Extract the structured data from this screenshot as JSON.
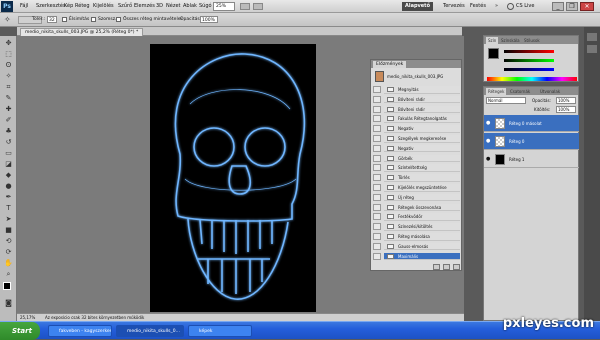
{
  "menu": {
    "logo": "Ps",
    "items": [
      "Fájl",
      "Szerkesztés",
      "Kép",
      "Réteg",
      "Kijelölés",
      "Szűrő",
      "Elemzés",
      "3D",
      "Nézet",
      "Ablak",
      "Súgó"
    ],
    "zoom": "25%",
    "workspaces": [
      "Alapvető",
      "Tervezés",
      "Festés"
    ],
    "ws_active": "Alapvető",
    "cslive": "CS Live"
  },
  "options": {
    "tolerance_label": "Toler.:",
    "tolerance_value": "32",
    "antialias": "Élsimítás",
    "contiguous": "Szomsz.",
    "all_layers": "Összes réteg mintavételei",
    "opacity_label": "Opacitás:",
    "opacity_value": "100%"
  },
  "document": {
    "tab": "medio_nikita_skulls_003.JPG @ 25,2% (Réteg 0*) *"
  },
  "history": {
    "title": "Előzmények",
    "snapshot": "medio_nikita_skulls_003.JPG",
    "steps": [
      "Megnyitás",
      "Bővíteni rádir",
      "Bővíteni rádir",
      "Fakulás Rétegtanolgatás",
      "Negatív",
      "Szegélyek megkeresése",
      "Negatív",
      "Görbék",
      "Színtelítettség",
      "Törlés",
      "Kijelölés megszüntetése",
      "Új réteg",
      "Rétegek összevonása",
      "Festékvödör",
      "Színezési/kitöltés",
      "Réteg másolása",
      "Gauss-elmosás",
      "Maximális"
    ],
    "selected_index": 17
  },
  "color": {
    "tabs": [
      "Szín",
      "Színskála",
      "Stílusok"
    ],
    "fg": "#000000",
    "bg": "#ffffff"
  },
  "layers": {
    "tabs": [
      "Rétegek",
      "Csatornák",
      "Útvonalak"
    ],
    "blend": "Normál",
    "opacity_label": "Opacitás:",
    "opacity": "100%",
    "fill_label": "Kitöltés:",
    "fill": "100%",
    "rows": [
      {
        "name": "Réteg 0 másolat",
        "selected": true
      },
      {
        "name": "Réteg 0",
        "selected": true
      },
      {
        "name": "Réteg 1",
        "selected": false
      }
    ]
  },
  "status": {
    "zoom": "25,17%",
    "text": "Az exposício csak 32 bites környezetben működik"
  },
  "taskbar": {
    "start": "Start",
    "items": [
      "fakveben - kagyszerkesztés",
      "medio_nikita_skulls_0...",
      "képek"
    ],
    "clock": "",
    "watermark": "pxleyes.com"
  }
}
